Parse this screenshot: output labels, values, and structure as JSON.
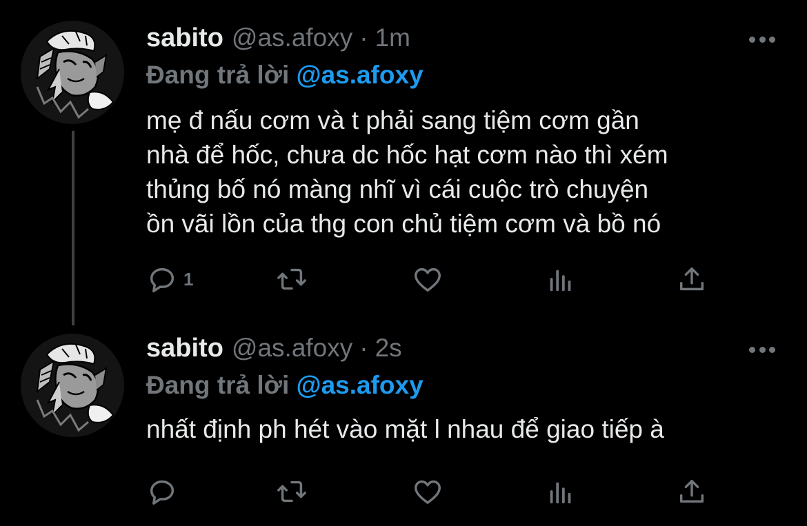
{
  "colors": {
    "background": "#000000",
    "text_primary": "#e7e9ea",
    "text_secondary": "#71767b",
    "mention": "#1d9bf0",
    "thread_line": "#3e4144"
  },
  "tweets": [
    {
      "name": "sabito",
      "handle": "@as.afoxy",
      "separator": "·",
      "time": "1m",
      "reply_prefix": "Đang trả lời",
      "reply_mention": "@as.afoxy",
      "text": "mẹ đ nấu cơm và t phải sang tiệm cơm gần\nnhà để hốc, chưa dc hốc hạt cơm nào thì xém\nthủng bố nó màng nhĩ vì cái cuộc trò chuyện\nồn vãi lồn của thg con chủ tiệm cơm và bồ nó",
      "reply_count": "1",
      "icons": [
        "comment-icon",
        "retweet-icon",
        "heart-icon",
        "views-icon",
        "share-icon",
        "more-icon"
      ]
    },
    {
      "name": "sabito",
      "handle": "@as.afoxy",
      "separator": "·",
      "time": "2s",
      "reply_prefix": "Đang trả lời",
      "reply_mention": "@as.afoxy",
      "text": "nhất định ph hét vào mặt l nhau để giao tiếp à",
      "reply_count": "",
      "icons": [
        "comment-icon",
        "retweet-icon",
        "heart-icon",
        "views-icon",
        "share-icon",
        "more-icon"
      ]
    }
  ]
}
